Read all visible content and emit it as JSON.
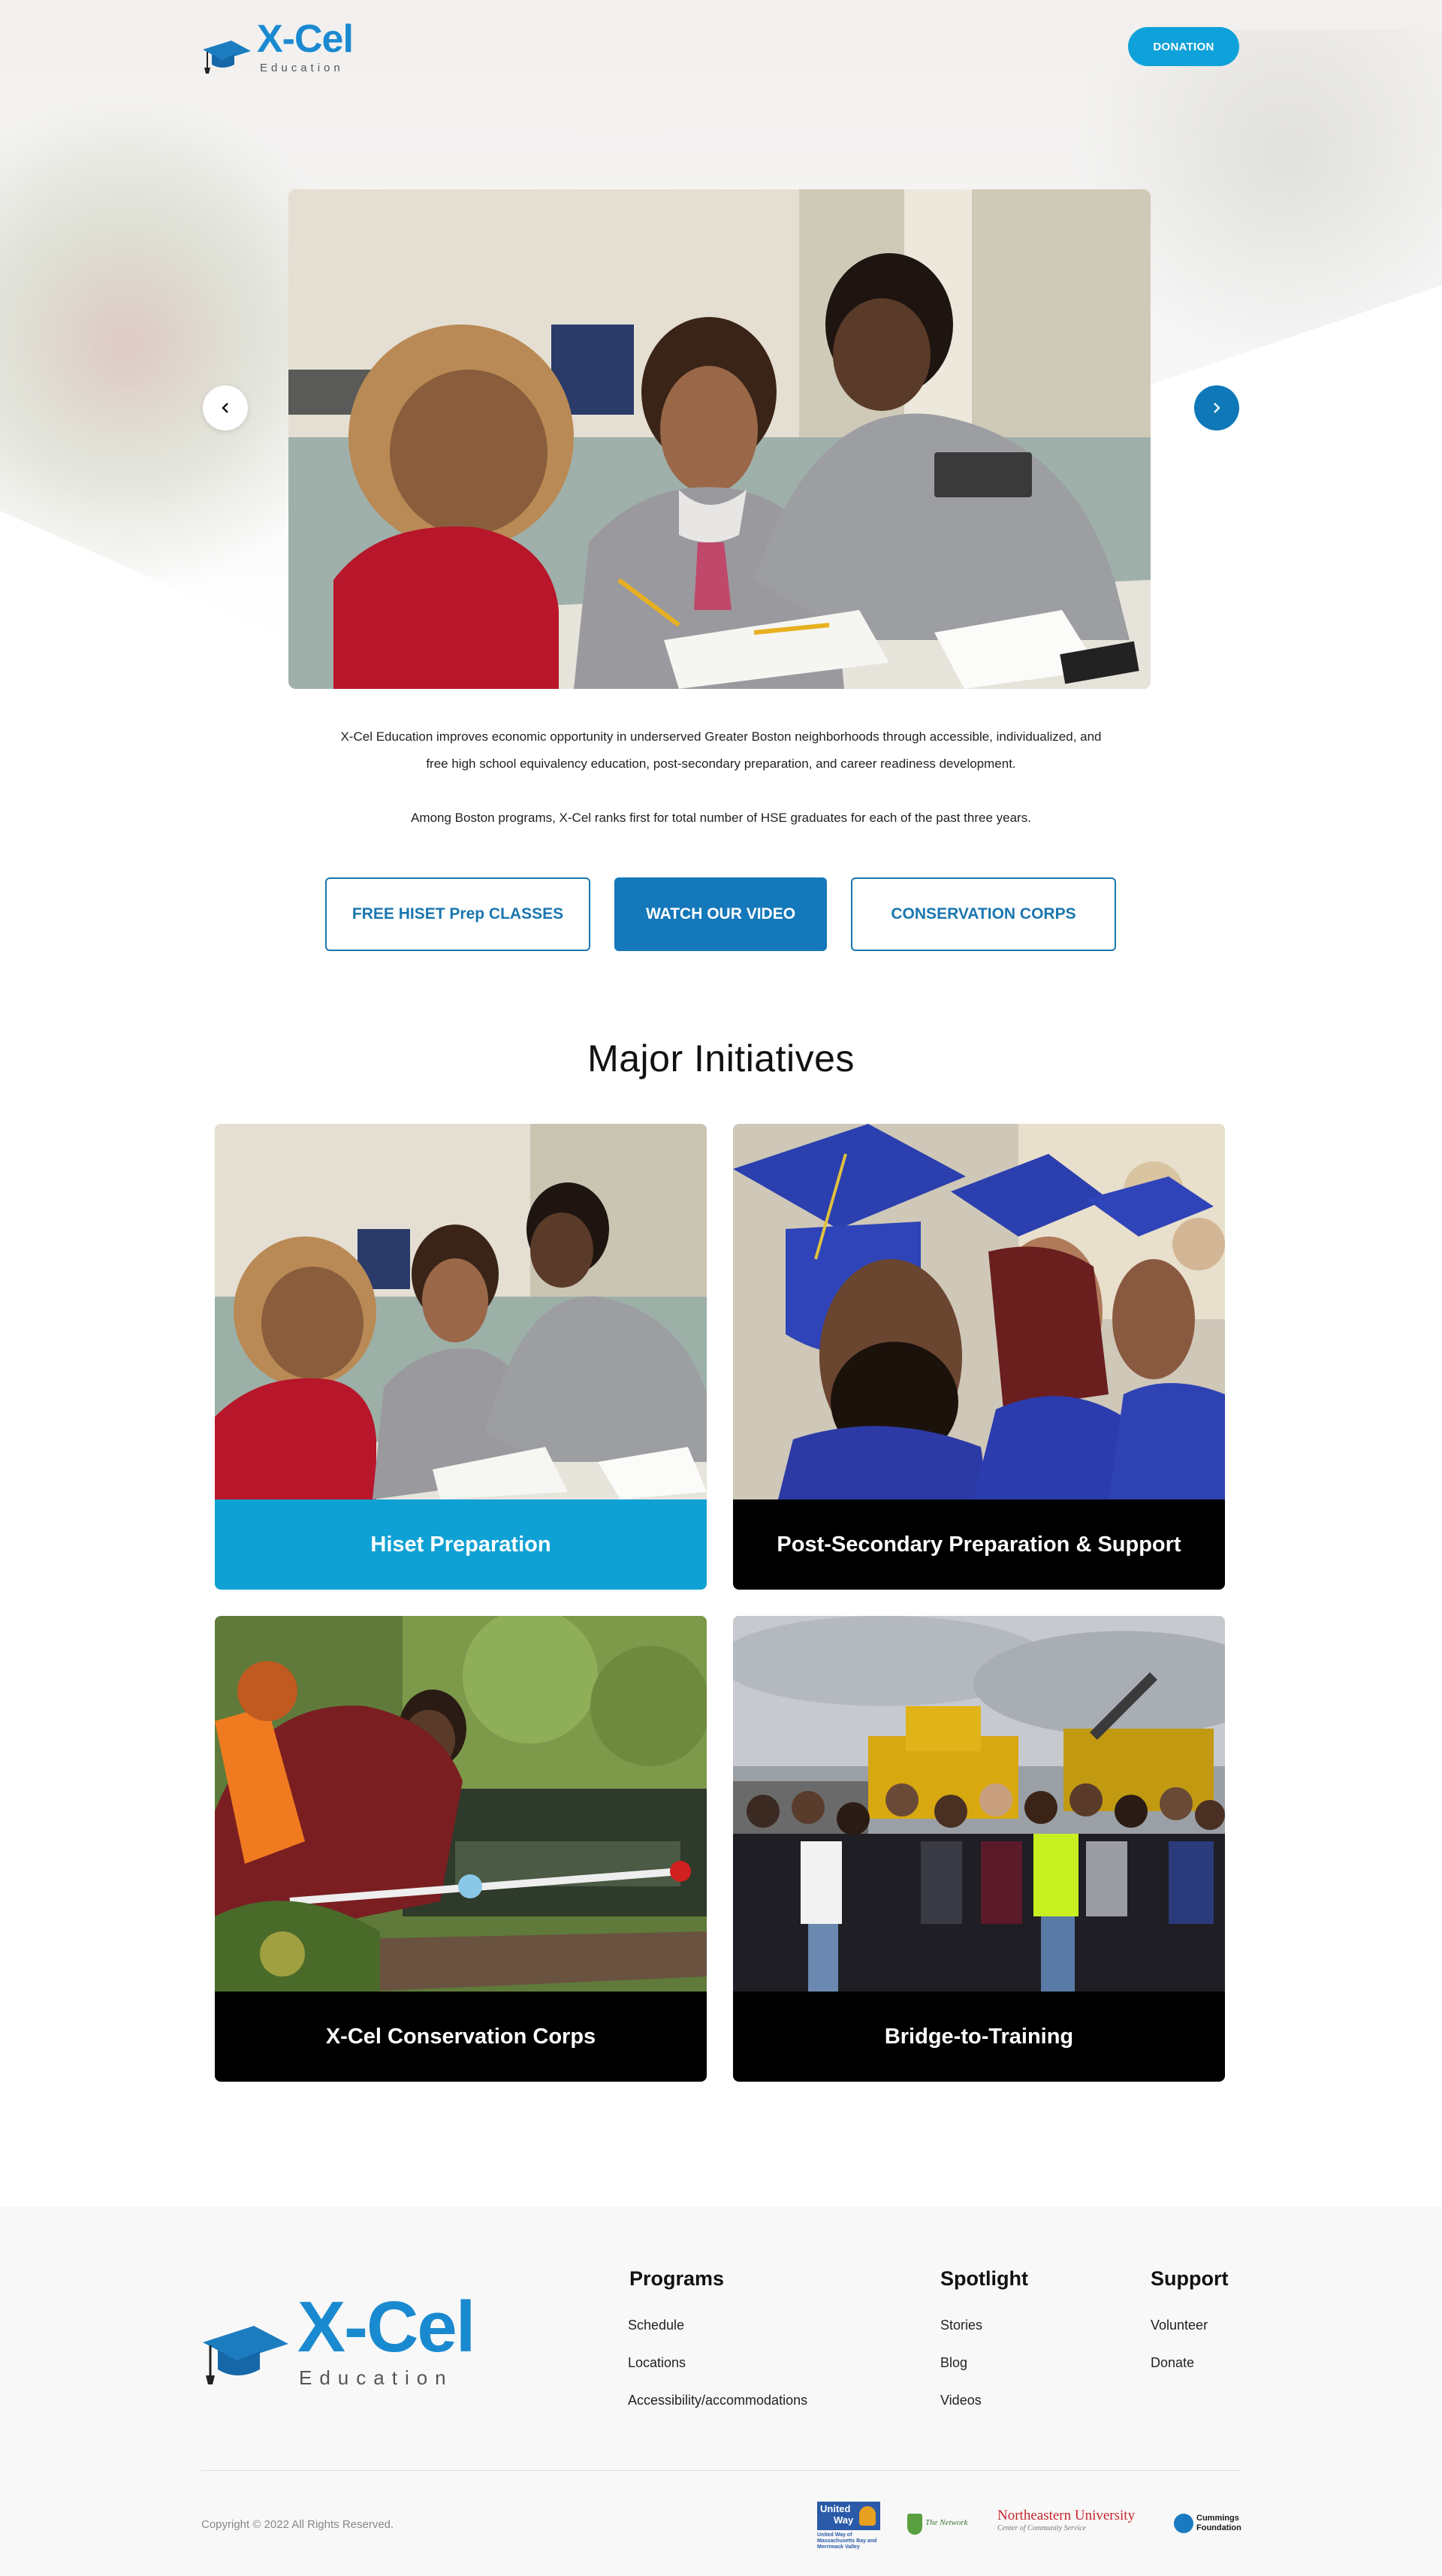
{
  "header": {
    "logo_primary": "X-Cel",
    "logo_secondary": "Education",
    "donate_label": "DONATION"
  },
  "intro": {
    "paragraph_1": "X-Cel Education improves economic opportunity in underserved Greater Boston neighborhoods through accessible, individualized, and free high school equivalency education, post-secondary preparation, and career readiness development.",
    "paragraph_2": "Among Boston programs, X-Cel ranks first for total number of HSE graduates for each of the past three years."
  },
  "cta": {
    "hiset_label": "FREE HISET Prep CLASSES",
    "video_label": "WATCH OUR VIDEO",
    "corps_label": "CONSERVATION CORPS"
  },
  "initiatives": {
    "title": "Major Initiatives",
    "cards": [
      {
        "label": "Hiset Preparation"
      },
      {
        "label": "Post-Secondary Preparation & Support"
      },
      {
        "label": "X-Cel Conservation Corps"
      },
      {
        "label": "Bridge-to-Training"
      }
    ]
  },
  "footer": {
    "logo_primary": "X-Cel",
    "logo_secondary": "Education",
    "columns": [
      {
        "title": "Programs",
        "links": [
          "Schedule",
          "Locations",
          "Accessibility/accommodations"
        ]
      },
      {
        "title": "Spotlight",
        "links": [
          "Stories",
          "Blog",
          "Videos"
        ]
      },
      {
        "title": "Support",
        "links": [
          "Volunteer",
          "Donate"
        ]
      }
    ],
    "copyright": "Copyright © 2022 All Rights Reserved.",
    "partners": {
      "united_way_line1": "United",
      "united_way_line2": "Way",
      "united_way_sub": "United Way of Massachusetts Bay and Merrimack Valley",
      "network_name": "The Network",
      "northeastern_name": "Northeastern University",
      "northeastern_sub": "Center of Community Service",
      "cummings_line1": "Cummings",
      "cummings_line2": "Foundation"
    }
  },
  "colors": {
    "brand_blue": "#1578ba",
    "light_blue": "#0fa1d9",
    "card_dark": "#000000"
  }
}
